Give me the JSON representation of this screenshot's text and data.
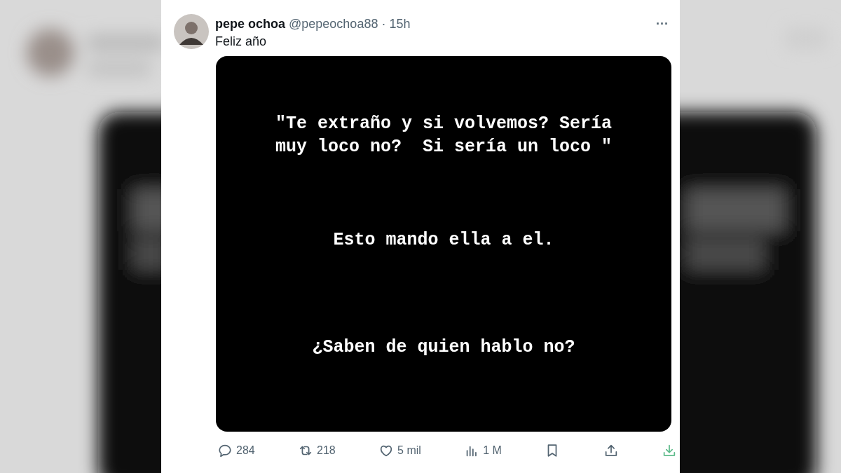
{
  "tweet": {
    "author_name": "pepe ochoa",
    "handle": "@pepeochoa88",
    "separator": "·",
    "time": "15h",
    "more": "···",
    "text": "Feliz año",
    "image": {
      "blocks": [
        {
          "lines": [
            "\"Te extraño y si volvemos? Sería",
            "muy loco no?  Si sería un loco \""
          ]
        },
        {
          "lines": [
            "Esto mando ella a el."
          ]
        },
        {
          "lines": [
            "¿Saben de quien hablo no?"
          ]
        }
      ]
    },
    "actions": [
      {
        "kind": "reply",
        "count": "284"
      },
      {
        "kind": "repost",
        "count": "218"
      },
      {
        "kind": "like",
        "count": "5 mil"
      },
      {
        "kind": "views",
        "count": "1 M"
      },
      {
        "kind": "bookmark"
      },
      {
        "kind": "share"
      },
      {
        "kind": "download"
      }
    ]
  }
}
